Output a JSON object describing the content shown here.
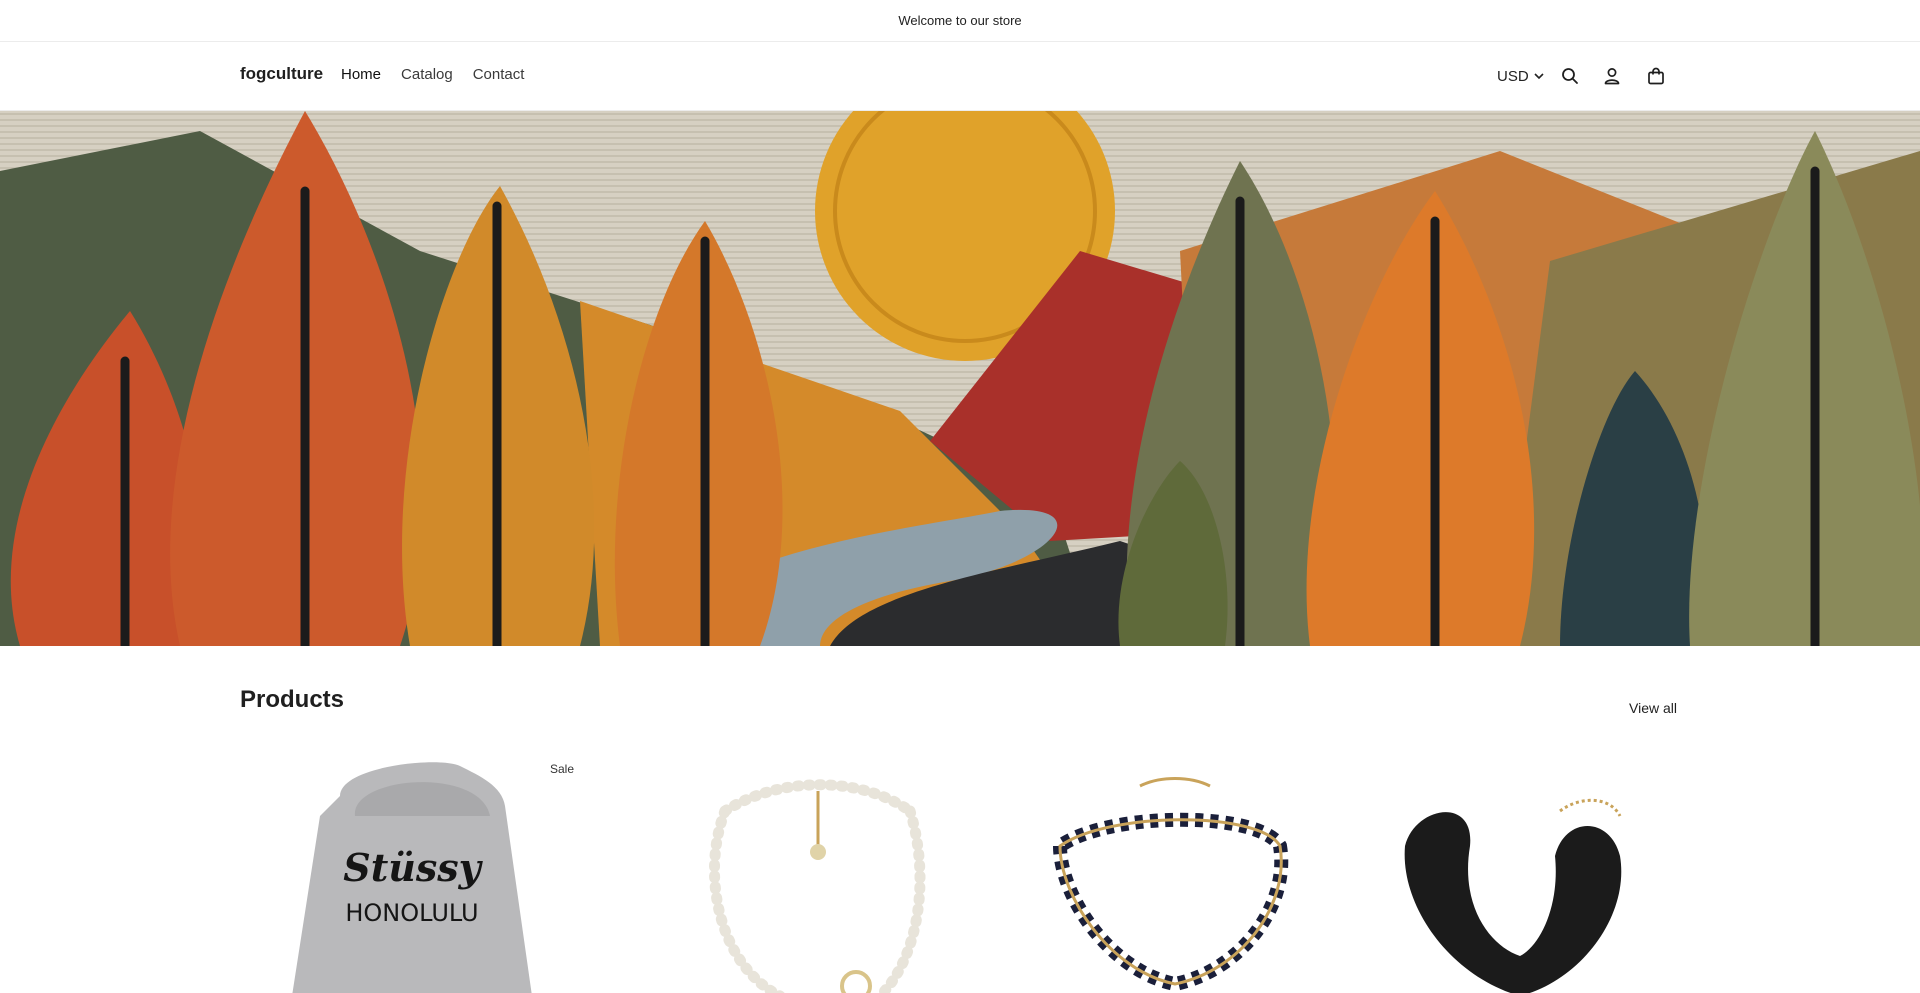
{
  "announcement": {
    "text": "Welcome to our store"
  },
  "header": {
    "logo": "fogculture",
    "nav": [
      {
        "label": "Home"
      },
      {
        "label": "Catalog"
      },
      {
        "label": "Contact"
      }
    ],
    "currency": "USD",
    "icons": [
      "search-icon",
      "account-icon",
      "cart-icon"
    ]
  },
  "hero": {
    "image": "quilted-autumn-landscape"
  },
  "products": {
    "title": "Products",
    "view_all": "View all",
    "items": [
      {
        "badge": "Sale",
        "image": "grey-hoodie"
      },
      {
        "badge": "",
        "image": "pearl-necklace"
      },
      {
        "badge": "",
        "image": "chain-necklace"
      },
      {
        "badge": "",
        "image": "leather-choker"
      }
    ]
  },
  "colors": {
    "text": "#1f1f1f",
    "border": "#ececec",
    "background": "#ffffff"
  }
}
